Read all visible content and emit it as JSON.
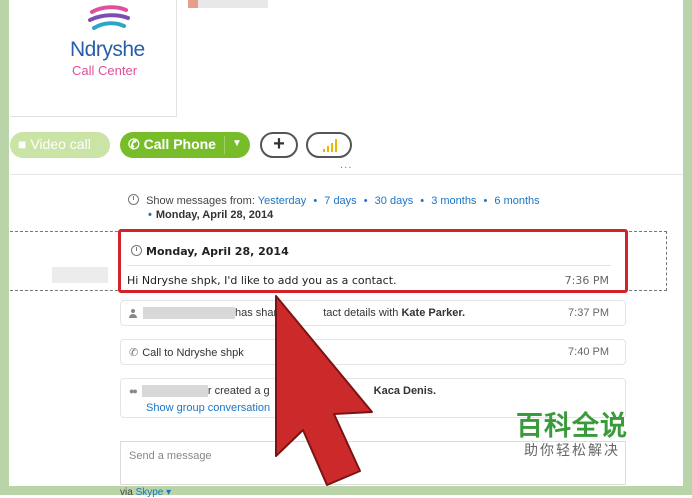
{
  "profile": {
    "logo_name": "Ndryshe",
    "logo_sub": "Call Center"
  },
  "toolbar": {
    "video_call_label": "Video call",
    "call_phone_label": "Call Phone",
    "add_label": "+",
    "more_label": "..."
  },
  "history": {
    "prefix": "Show messages from:",
    "options": [
      "Yesterday",
      "7 days",
      "30 days",
      "3 months",
      "6 months"
    ],
    "selected_date": "Monday, April 28, 2014"
  },
  "highlighted_message": {
    "date": "Monday, April 28, 2014",
    "text": "Hi Ndryshe  shpk, I'd like to add you as a contact.",
    "time": "7:36 PM"
  },
  "messages": [
    {
      "text_a": "has shar",
      "text_b": "tact details with",
      "bold": "Kate Parker.",
      "time": "7:37 PM"
    },
    {
      "text": "Call to Ndryshe  shpk",
      "time": "7:40 PM"
    },
    {
      "text_a": "r created a g",
      "bold": "Kaca Denis.",
      "link": "Show group conversation"
    }
  ],
  "composer": {
    "placeholder": "Send a message",
    "via_prefix": "via",
    "via_service": "Skype ▾"
  },
  "watermark": {
    "title": "百科全说",
    "subtitle": "助你轻松解决"
  },
  "colors": {
    "call_green": "#77bd2a",
    "link_blue": "#1a75c5",
    "highlight_red": "#d2232a",
    "frame_green": "#b8d4a8"
  }
}
